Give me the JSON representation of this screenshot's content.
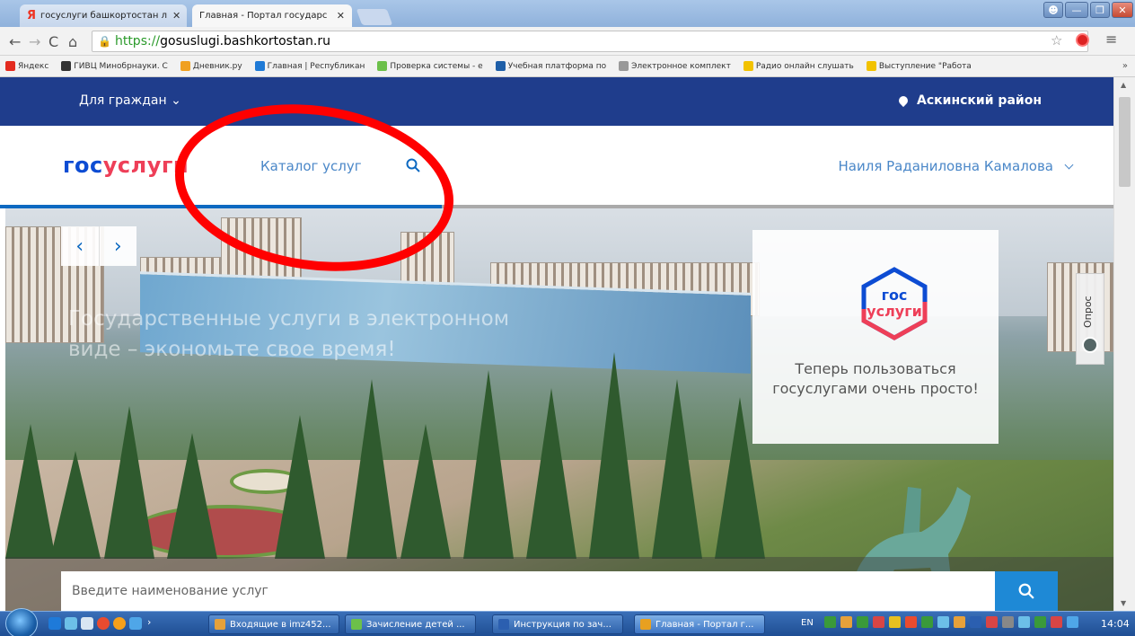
{
  "browser": {
    "tabs": [
      {
        "label": "госуслуги башкортостан л",
        "favicon": "yandex-icon"
      },
      {
        "label": "Главная - Портал государс",
        "favicon": "page-icon"
      }
    ],
    "url_scheme": "https://",
    "url_host": "gosuslugi.bashkortostan.ru",
    "bookmarks": [
      {
        "label": "Яндекс",
        "icon": "yandex-icon",
        "color": "#e32b1f"
      },
      {
        "label": "ГИВЦ Минобрнауки. С",
        "icon": "bird-icon",
        "color": "#333333"
      },
      {
        "label": "Дневник.ру",
        "icon": "diary-icon",
        "color": "#f0a020"
      },
      {
        "label": "Главная | Республикан",
        "icon": "circle-icon",
        "color": "#1f7ad6"
      },
      {
        "label": "Проверка системы - e",
        "icon": "dot-icon",
        "color": "#6cc04a"
      },
      {
        "label": "Учебная платформа по",
        "icon": "platform-icon",
        "color": "#1f5fa8"
      },
      {
        "label": "Электронное комплект",
        "icon": "page-icon",
        "color": "#999999"
      },
      {
        "label": "Радио онлайн слушать",
        "icon": "folder-icon",
        "color": "#f2c200"
      },
      {
        "label": "Выступление \"Работа",
        "icon": "doc-icon",
        "color": "#f2c200"
      }
    ],
    "bookmarks_more": "»"
  },
  "site": {
    "top_bar": {
      "for_citizens": "Для граждан",
      "region": "Аскинский район"
    },
    "header": {
      "logo_part1": "гос",
      "logo_part2": "услу",
      "logo_part3": "ги",
      "catalog": "Каталог услуг",
      "user_name": "Наиля Раданиловна Камалова"
    },
    "hero": {
      "slide_text": "Государственные услуги в электронном виде – экономьте свое время!",
      "arrow_prev": "‹",
      "arrow_next": "›",
      "promo_logo_line1": "гос",
      "promo_logo_line2": "услуги",
      "promo_text": "Теперь пользоваться госуслугами очень просто!",
      "poll_tab": "Опрос"
    },
    "search": {
      "placeholder": "Введите наименование услуг"
    },
    "colors": {
      "brand_blue": "#0d4cd3",
      "brand_red": "#ee3f58",
      "top_bar": "#1f3d8c",
      "link_blue": "#4a87c8",
      "search_button": "#1e89d6",
      "annotation": "#ff0000"
    }
  },
  "taskbar": {
    "items": [
      {
        "label": "Входящие в imz452...",
        "color": "#e6a13a"
      },
      {
        "label": "Зачисление детей ...",
        "color": "#6cc04a"
      },
      {
        "label": "Инструкция по зач...",
        "color": "#2b5fb0"
      },
      {
        "label": "Главная - Портал г...",
        "color": "#e8a020",
        "active": true
      }
    ],
    "lang": "EN",
    "clock": "14:04"
  }
}
